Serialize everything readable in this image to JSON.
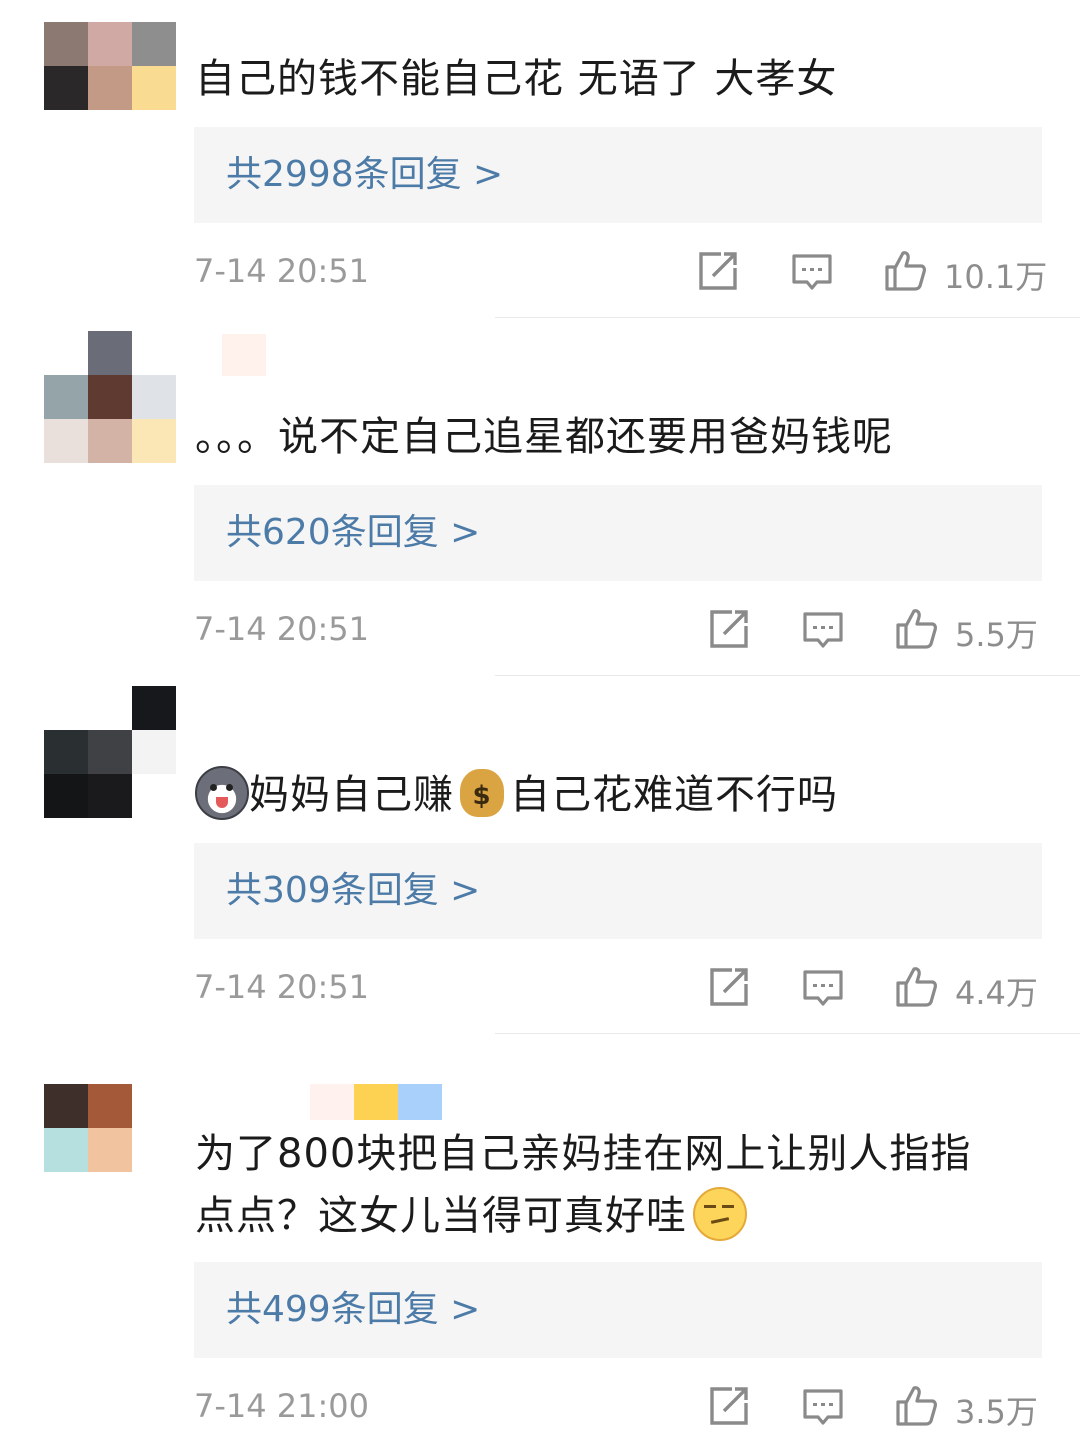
{
  "comments": [
    {
      "text": "自己的钱不能自己花 无语了 大孝女",
      "reply_label": "共2998条回复 >",
      "timestamp": "7-14 20:51",
      "likes": "10.1万"
    },
    {
      "text": "。。。说不定自己追星都还要用爸妈钱呢",
      "reply_label": "共620条回复 >",
      "timestamp": "7-14 20:51",
      "likes": "5.5万"
    },
    {
      "text_a": "妈妈自己赚",
      "text_b": "自己花难道不行吗",
      "emoji_a": "husky-face",
      "emoji_b": "money-bag",
      "reply_label": "共309条回复 >",
      "timestamp": "7-14 20:51",
      "likes": "4.4万"
    },
    {
      "line1": "为了800块把自己亲妈挂在网上让别人指指",
      "line2": "点点？这女儿当得可真好哇",
      "emoji": "smirk-face",
      "reply_label": "共499条回复 >",
      "timestamp": "7-14 21:00",
      "likes": "3.5万"
    }
  ],
  "icons": {
    "share": "share-icon",
    "comment": "comment-icon",
    "like": "thumbs-up-icon"
  }
}
